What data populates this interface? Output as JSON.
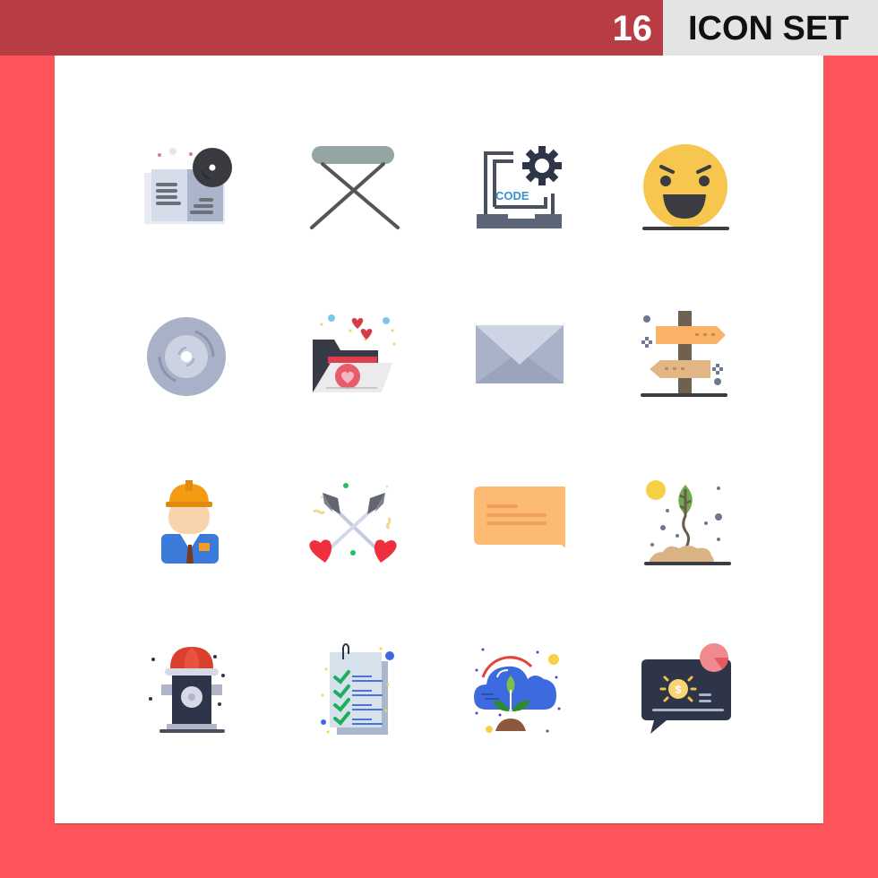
{
  "header": {
    "count": "16",
    "label": "ICON SET"
  },
  "colors": {
    "background": "#ff5459",
    "header_bar": "#b83c43",
    "label_box": "#e4e4e4",
    "panel": "#ffffff"
  },
  "icons": [
    {
      "name": "book-cd-icon"
    },
    {
      "name": "folding-stool-icon"
    },
    {
      "name": "laptop-code-gear-icon"
    },
    {
      "name": "smirking-emoji-icon"
    },
    {
      "name": "disc-icon"
    },
    {
      "name": "love-folder-icon"
    },
    {
      "name": "envelope-icon"
    },
    {
      "name": "signpost-icon"
    },
    {
      "name": "engineer-worker-icon"
    },
    {
      "name": "crossed-love-arrows-icon"
    },
    {
      "name": "chat-bubble-icon"
    },
    {
      "name": "plant-growth-icon"
    },
    {
      "name": "fire-hydrant-icon"
    },
    {
      "name": "checklist-document-icon"
    },
    {
      "name": "cloud-plant-icon"
    },
    {
      "name": "money-chat-pie-icon"
    }
  ],
  "code_text": "CODE",
  "dollar_text": "$"
}
